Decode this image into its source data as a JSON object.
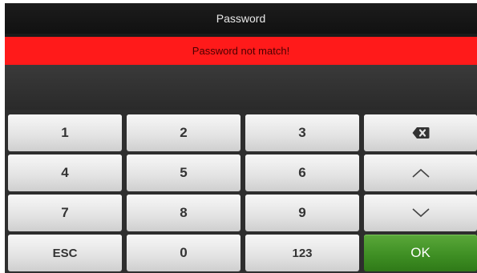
{
  "header": {
    "title": "Password"
  },
  "alert": {
    "message": "Password not match!",
    "color": "#ff1a1a"
  },
  "keypad": {
    "keys": {
      "k1": "1",
      "k2": "2",
      "k3": "3",
      "k4": "4",
      "k5": "5",
      "k6": "6",
      "k7": "7",
      "k8": "8",
      "k9": "9",
      "k0": "0",
      "esc": "ESC",
      "mode": "123",
      "ok": "OK"
    },
    "icons": {
      "backspace": "backspace-icon",
      "up": "arrow-up-icon",
      "down": "arrow-down-icon"
    },
    "ok_color": "#3f8f24"
  }
}
